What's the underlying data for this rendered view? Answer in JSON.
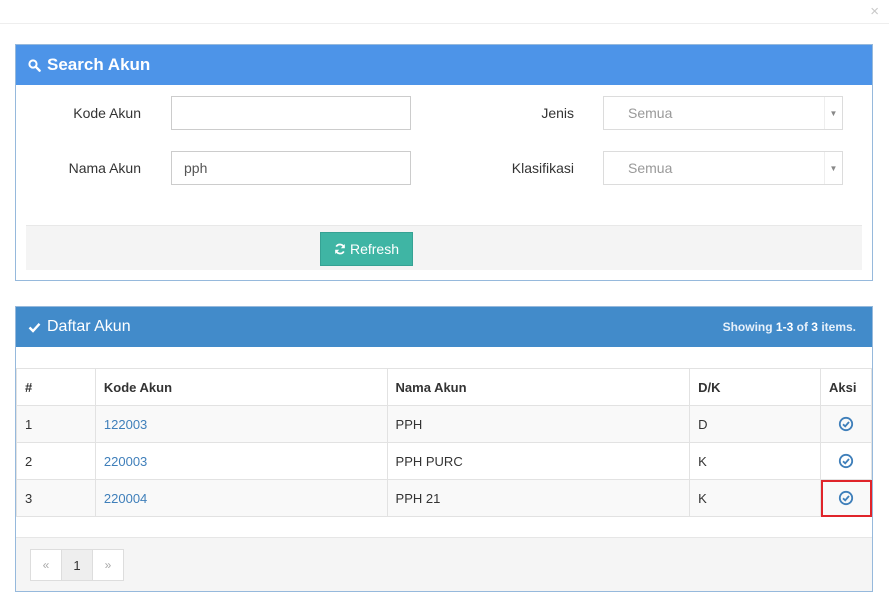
{
  "window": {
    "close_glyph": "×"
  },
  "search": {
    "title": "Search Akun",
    "icon": "search-icon",
    "kode_label": "Kode Akun",
    "kode_value": "",
    "nama_label": "Nama Akun",
    "nama_value": "pph",
    "jenis_label": "Jenis",
    "jenis_value": "Semua",
    "klasifikasi_label": "Klasifikasi",
    "klasifikasi_value": "Semua",
    "refresh_label": "Refresh"
  },
  "list": {
    "title": "Daftar Akun",
    "icon": "check-icon",
    "summary_prefix": "Showing",
    "summary_range": "1-3",
    "summary_of": "of",
    "summary_total": "3",
    "summary_suffix": "items.",
    "columns": [
      "#",
      "Kode Akun",
      "Nama Akun",
      "D/K",
      "Aksi"
    ],
    "rows": [
      {
        "no": "1",
        "kode": "122003",
        "nama": "PPH",
        "dk": "D"
      },
      {
        "no": "2",
        "kode": "220003",
        "nama": "PPH PURC",
        "dk": "K"
      },
      {
        "no": "3",
        "kode": "220004",
        "nama": "PPH 21",
        "dk": "K"
      }
    ]
  },
  "pagination": {
    "prev": "«",
    "current": "1",
    "next": "»"
  },
  "colors": {
    "search_header": "#4d94e8",
    "list_header": "#428bca",
    "refresh": "#3fb5a4",
    "link": "#3f7fba",
    "highlight": "#e0242a"
  }
}
